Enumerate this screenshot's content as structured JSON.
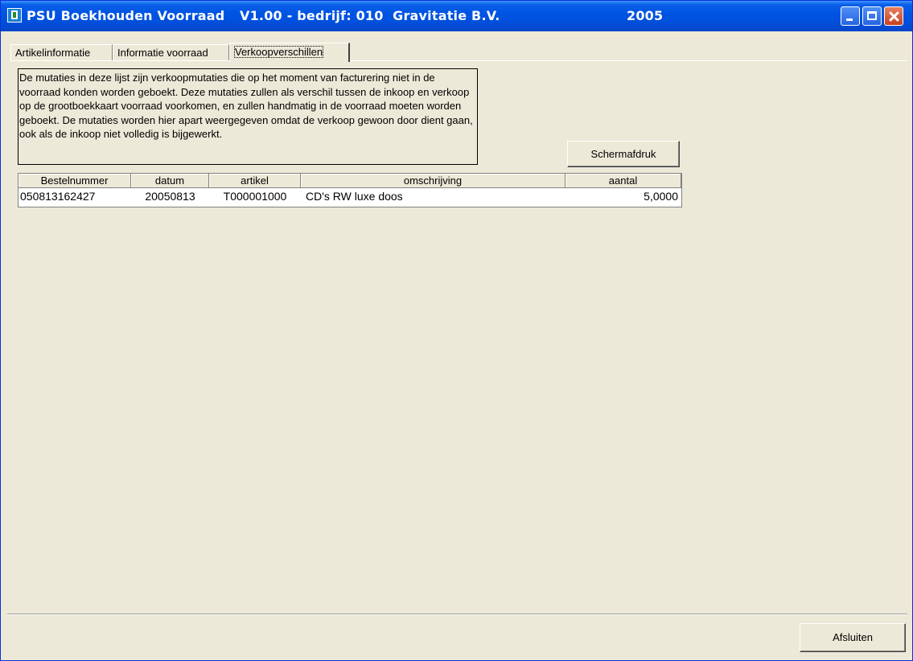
{
  "window": {
    "title_app": "PSU Boekhouden Voorraad",
    "title_version": "V1.00 - bedrijf: 010  Gravitatie B.V.",
    "title_year": "2005",
    "minimize_label": "Minimize",
    "maximize_label": "Maximize",
    "close_label": "Close"
  },
  "tabs": [
    {
      "label": "Artikelinformatie"
    },
    {
      "label": "Informatie voorraad"
    },
    {
      "label": "Verkoopverschillen"
    }
  ],
  "info_text": "De mutaties in deze lijst zijn verkoopmutaties die op het moment van facturering niet in de voorraad konden worden geboekt. Deze mutaties zullen als verschil tussen de inkoop en verkoop op de grootboekkaart voorraad voorkomen, en zullen handmatig in de voorraad moeten worden geboekt. De mutaties worden hier apart weergegeven omdat de verkoop gewoon door dient gaan, ook als de inkoop niet volledig is bijgewerkt.",
  "buttons": {
    "print_label": "Schermafdruk",
    "close_label": "Afsluiten"
  },
  "table": {
    "columns": [
      "Bestelnummer",
      "datum",
      "artikel",
      "omschrijving",
      "aantal"
    ],
    "rows": [
      [
        "050813162427",
        "20050813",
        "T000001000",
        "CD's RW luxe doos",
        "5,0000"
      ]
    ]
  }
}
